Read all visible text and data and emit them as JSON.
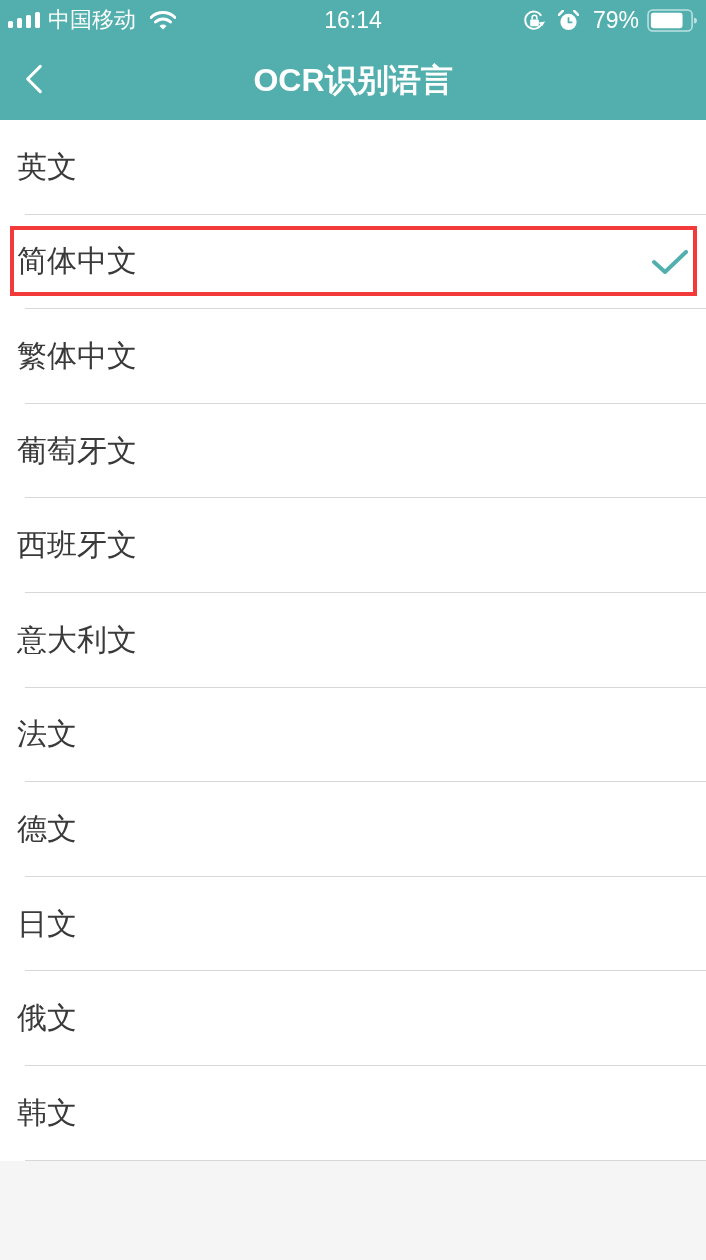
{
  "status_bar": {
    "carrier": "中国移动",
    "time": "16:14",
    "battery": "79%"
  },
  "nav_bar": {
    "title": "OCR识别语言"
  },
  "languages": [
    {
      "label": "英文",
      "selected": false,
      "highlighted": false
    },
    {
      "label": "简体中文",
      "selected": true,
      "highlighted": true
    },
    {
      "label": "繁体中文",
      "selected": false,
      "highlighted": false
    },
    {
      "label": "葡萄牙文",
      "selected": false,
      "highlighted": false
    },
    {
      "label": "西班牙文",
      "selected": false,
      "highlighted": false
    },
    {
      "label": "意大利文",
      "selected": false,
      "highlighted": false
    },
    {
      "label": "法文",
      "selected": false,
      "highlighted": false
    },
    {
      "label": "德文",
      "selected": false,
      "highlighted": false
    },
    {
      "label": "日文",
      "selected": false,
      "highlighted": false
    },
    {
      "label": "俄文",
      "selected": false,
      "highlighted": false
    },
    {
      "label": "韩文",
      "selected": false,
      "highlighted": false
    }
  ]
}
